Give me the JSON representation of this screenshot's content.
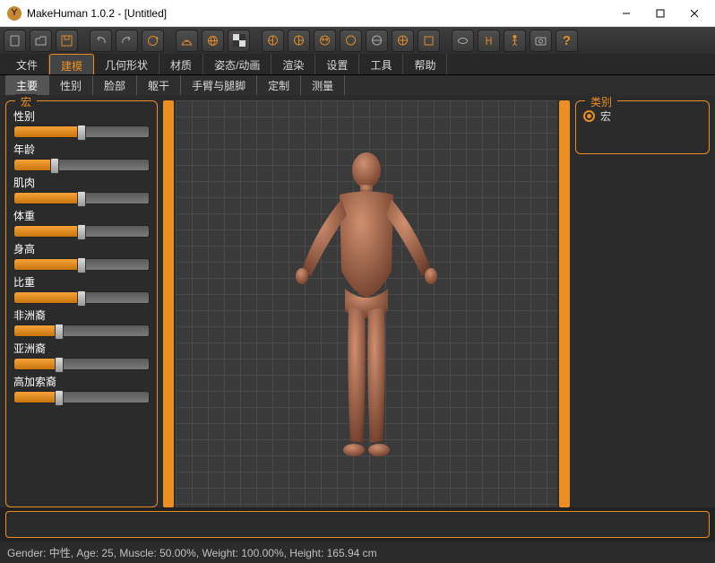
{
  "window": {
    "app_icon": "Y",
    "title": "MakeHuman 1.0.2 - [Untitled]"
  },
  "menubar": {
    "items": [
      "文件",
      "建模",
      "几何形状",
      "材质",
      "姿态/动画",
      "渲染",
      "设置",
      "工具",
      "帮助"
    ],
    "active_index": 1
  },
  "subtabs": {
    "items": [
      "主要",
      "性别",
      "脸部",
      "躯干",
      "手臂与腿脚",
      "定制",
      "测量"
    ],
    "active_index": 0
  },
  "macro_panel": {
    "title": "宏",
    "sliders": [
      {
        "label": "性别",
        "value": 50
      },
      {
        "label": "年龄",
        "value": 30
      },
      {
        "label": "肌肉",
        "value": 50
      },
      {
        "label": "体重",
        "value": 50
      },
      {
        "label": "身高",
        "value": 50
      },
      {
        "label": "比重",
        "value": 50
      },
      {
        "label": "非洲裔",
        "value": 33
      },
      {
        "label": "亚洲裔",
        "value": 33
      },
      {
        "label": "高加索裔",
        "value": 33
      }
    ]
  },
  "category_panel": {
    "title": "类别",
    "option": "宏"
  },
  "toolbar_icons": [
    "new",
    "open",
    "save",
    "sep",
    "undo",
    "redo",
    "reload",
    "sep",
    "wireframe",
    "globe",
    "checker",
    "sep",
    "view-left",
    "view-right",
    "view-front",
    "view-back",
    "view-top",
    "view-persp",
    "view-ortho",
    "sep",
    "select",
    "pose",
    "figure",
    "camera",
    "help"
  ],
  "status": {
    "text": "Gender: 中性, Age: 25, Muscle: 50.00%, Weight: 100.00%, Height: 165.94 cm"
  }
}
